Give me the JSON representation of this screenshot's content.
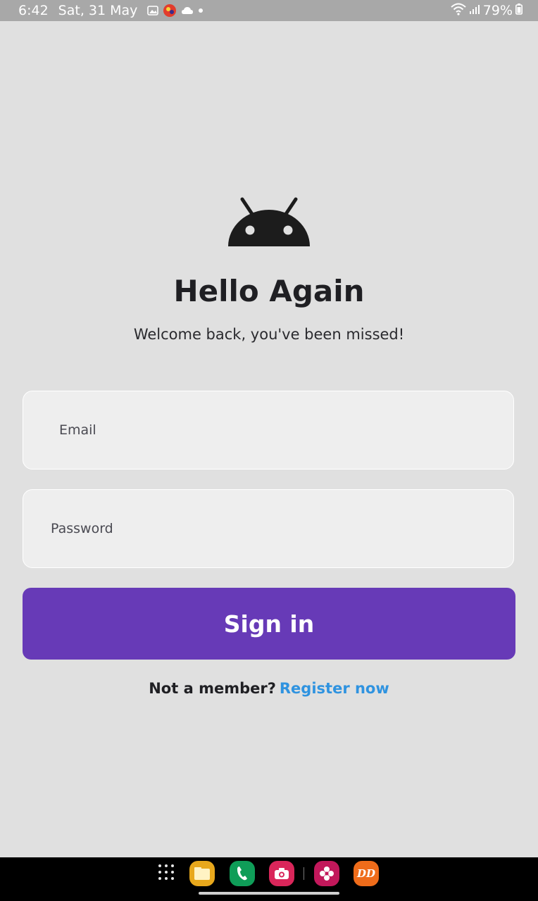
{
  "status_bar": {
    "time": "6:42",
    "date": "Sat, 31 May",
    "notifications": [
      "image-icon",
      "game-app-icon",
      "cloud-icon",
      "dot-icon"
    ],
    "battery": "79%",
    "icons": [
      "wifi-icon",
      "signal-icon",
      "battery-icon"
    ]
  },
  "login": {
    "logo": "android-head-icon",
    "title": "Hello Again",
    "subtitle": "Welcome back, you've been missed!",
    "email_placeholder": "Email",
    "password_placeholder": "Password",
    "signin_label": "Sign in",
    "register_prompt": "Not a member?",
    "register_link": "Register now"
  },
  "colors": {
    "background": "#e0e0e0",
    "primary": "#673ab7",
    "link": "#2f93e0",
    "field_bg": "#eeeeee"
  },
  "taskbar": {
    "apps": [
      "app-drawer-icon",
      "files-app-icon",
      "phone-app-icon",
      "camera-app-icon",
      "gallery-app-icon",
      "dd-app-icon"
    ],
    "dd_label": "DD"
  }
}
